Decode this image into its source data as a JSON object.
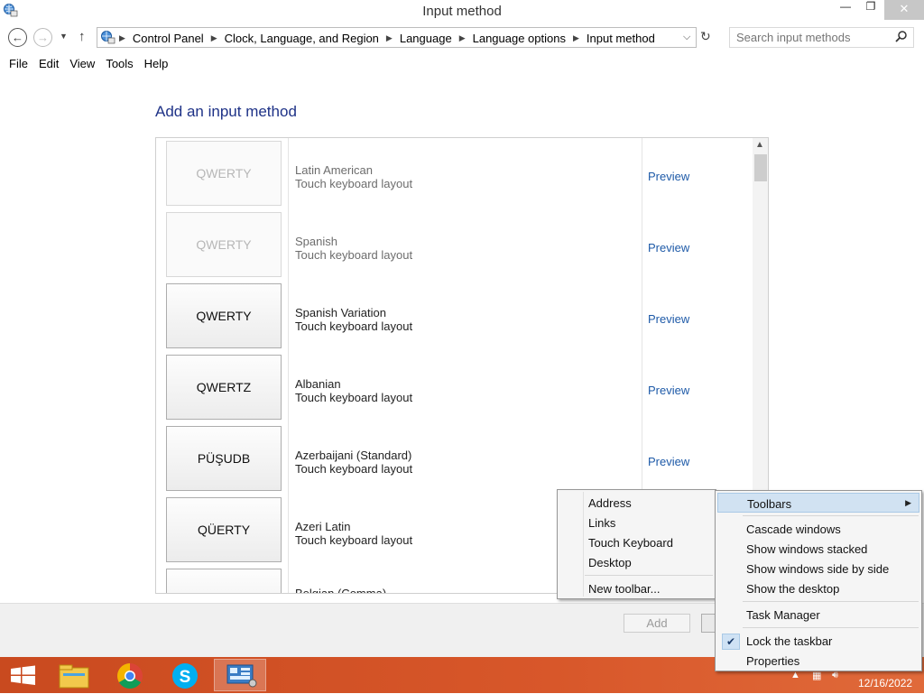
{
  "window": {
    "title": "Input method",
    "minimize_glyph": "—",
    "maximize_glyph": "❐",
    "close_glyph": "✕"
  },
  "nav": {
    "breadcrumbs": [
      "Control Panel",
      "Clock, Language, and Region",
      "Language",
      "Language options",
      "Input method"
    ],
    "search_placeholder": "Search input methods"
  },
  "menu": [
    "File",
    "Edit",
    "View",
    "Tools",
    "Help"
  ],
  "page": {
    "heading": "Add an input method",
    "rows": [
      {
        "tile": "QWERTY",
        "name": "Latin American",
        "type": "Touch keyboard layout",
        "preview": "Preview",
        "dimmed": true
      },
      {
        "tile": "QWERTY",
        "name": "Spanish",
        "type": "Touch keyboard layout",
        "preview": "Preview",
        "dimmed": true
      },
      {
        "tile": "QWERTY",
        "name": "Spanish Variation",
        "type": "Touch keyboard layout",
        "preview": "Preview",
        "dimmed": false
      },
      {
        "tile": "QWERTZ",
        "name": "Albanian",
        "type": "Touch keyboard layout",
        "preview": "Preview",
        "dimmed": false
      },
      {
        "tile": "PÜŞUDB",
        "name": "Azerbaijani (Standard)",
        "type": "Touch keyboard layout",
        "preview": "Preview",
        "dimmed": false
      },
      {
        "tile": "QÜERTY",
        "name": "Azeri Latin",
        "type": "Touch keyboard layout",
        "preview": "",
        "dimmed": false
      },
      {
        "tile": "",
        "name": "Belgian (Comma)",
        "type": "",
        "preview": "",
        "dimmed": false
      }
    ]
  },
  "buttons": {
    "add": "Add"
  },
  "context_menu": {
    "items": [
      "Toolbars",
      "Cascade windows",
      "Show windows stacked",
      "Show windows side by side",
      "Show the desktop",
      "Task Manager",
      "Lock the taskbar",
      "Properties"
    ],
    "highlighted": "Toolbars",
    "checked": "Lock the taskbar"
  },
  "submenu": {
    "items": [
      "Address",
      "Links",
      "Touch Keyboard",
      "Desktop",
      "New toolbar..."
    ]
  },
  "taskbar": {
    "apps": [
      "windows-start-icon",
      "file-explorer-icon",
      "chrome-icon",
      "skype-icon",
      "control-panel-icon"
    ],
    "clock": "12/16/2022"
  },
  "colors": {
    "heading": "#1e3287",
    "link": "#1e5aa8",
    "taskbar": "#d8572a",
    "menu_highlight": "#d1e2f2"
  }
}
